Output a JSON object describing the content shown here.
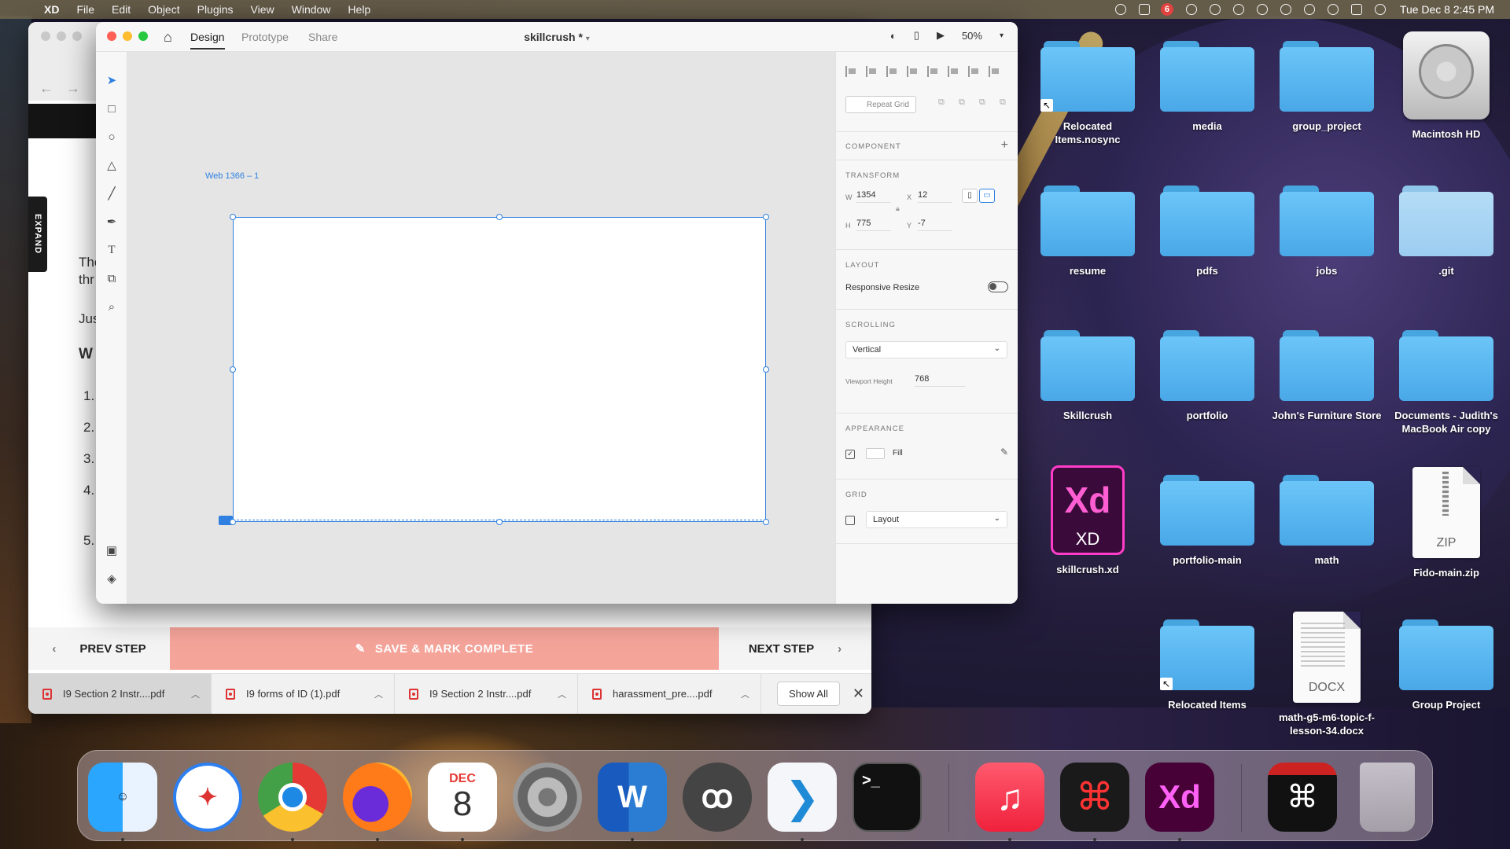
{
  "menubar": {
    "app_name": "XD",
    "items": [
      "File",
      "Edit",
      "Object",
      "Plugins",
      "View",
      "Window",
      "Help"
    ],
    "notification_count": "6",
    "clock": "Tue Dec 8  2:45 PM"
  },
  "browser": {
    "sidebar_expand": "EXPAND",
    "page_fragments": [
      "The",
      "thr",
      "Jus",
      "W",
      "1.",
      "2.",
      "3.",
      "4.",
      "5."
    ],
    "prev_step": "PREV STEP",
    "save_complete": "SAVE & MARK COMPLETE",
    "next_step": "NEXT STEP",
    "downloads": [
      {
        "name": "I9 Section 2 Instr....pdf"
      },
      {
        "name": "I9 forms of ID (1).pdf"
      },
      {
        "name": "I9 Section 2 Instr....pdf"
      },
      {
        "name": "harassment_pre....pdf"
      }
    ],
    "show_all": "Show All"
  },
  "xd": {
    "tabs": [
      "Design",
      "Prototype",
      "Share"
    ],
    "active_tab": "Design",
    "doc_title": "skillcrush *",
    "zoom": "50%",
    "artboard_label": "Web 1366 – 1",
    "panel": {
      "repeat_grid": "Repeat Grid",
      "component_head": "COMPONENT",
      "transform_head": "TRANSFORM",
      "w_label": "W",
      "w_value": "1354",
      "h_label": "H",
      "h_value": "775",
      "x_label": "X",
      "x_value": "12",
      "y_label": "Y",
      "y_value": "-7",
      "layout_head": "LAYOUT",
      "responsive_resize": "Responsive Resize",
      "responsive_on": false,
      "scrolling_head": "SCROLLING",
      "scrolling_value": "Vertical",
      "viewport_label": "Viewport Height",
      "viewport_value": "768",
      "appearance_head": "APPEARANCE",
      "fill_label": "Fill",
      "fill_checked": true,
      "grid_head": "GRID",
      "grid_value": "Layout",
      "grid_checked": false
    },
    "accent_color": "#2f80e0"
  },
  "desktop": {
    "icons": [
      {
        "label": "Relocated Items.nosync",
        "kind": "folder-alias"
      },
      {
        "label": "media",
        "kind": "folder"
      },
      {
        "label": "group_project",
        "kind": "folder"
      },
      {
        "label": "Macintosh HD",
        "kind": "drive"
      },
      {
        "label": "resume",
        "kind": "folder"
      },
      {
        "label": "pdfs",
        "kind": "folder"
      },
      {
        "label": "jobs",
        "kind": "folder"
      },
      {
        "label": ".git",
        "kind": "folder-light"
      },
      {
        "label": "Skillcrush",
        "kind": "folder"
      },
      {
        "label": "portfolio",
        "kind": "folder"
      },
      {
        "label": "John's Furniture Store",
        "kind": "folder"
      },
      {
        "label": "Documents - Judith's MacBook Air copy",
        "kind": "folder"
      },
      {
        "label": "skillcrush.xd",
        "kind": "xd-file",
        "icon_text_big": "Xd",
        "icon_text_small": "XD"
      },
      {
        "label": "portfolio-main",
        "kind": "folder"
      },
      {
        "label": "math",
        "kind": "folder"
      },
      {
        "label": "Fido-main.zip",
        "kind": "zip",
        "icon_text": "ZIP"
      },
      {
        "label": "Relocated Items",
        "kind": "folder-alias"
      },
      {
        "label": "math-g5-m6-topic-f-lesson-34.docx",
        "kind": "docx",
        "icon_text": "DOCX"
      },
      {
        "label": "Group Project",
        "kind": "folder"
      }
    ]
  },
  "dock": {
    "apps": [
      "finder-icon",
      "safari-icon",
      "chrome-icon",
      "firefox-icon",
      "calendar-icon",
      "system-preferences-icon",
      "word-icon",
      "mamp-icon",
      "vscode-icon",
      "terminal-icon",
      "music-icon",
      "acrobat-icon",
      "adobe-xd-icon",
      "pdf-stack-icon",
      "trash-icon"
    ],
    "calendar_month": "DEC",
    "calendar_day": "8",
    "word_letter": "W",
    "xd_letters": "Xd",
    "terminal_prompt": ">_"
  }
}
